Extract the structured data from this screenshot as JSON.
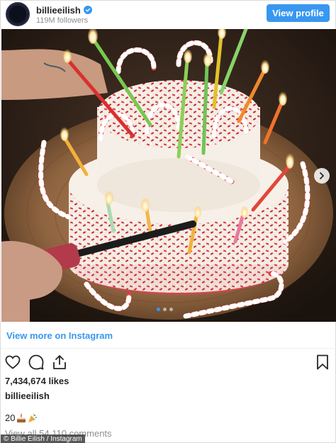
{
  "header": {
    "username": "billieeilish",
    "followers": "119M followers",
    "view_profile_label": "View profile"
  },
  "post": {
    "image_subject": "birthday cake with candy canes and lit candles",
    "carousel": {
      "count": 3,
      "active_index": 0
    },
    "view_more_label": "View more on Instagram",
    "likes": "7,434,674 likes",
    "caption_user": "billieeilish",
    "caption_text": "20",
    "view_comments": "View all 54,110 comments"
  },
  "icons": {
    "verified": "verified-badge-icon",
    "like": "heart-icon",
    "comment": "comment-icon",
    "share": "share-icon",
    "save": "bookmark-icon",
    "next": "chevron-right-icon"
  },
  "colors": {
    "accent": "#3897f0",
    "text": "#262626",
    "muted": "#8e8e8e"
  },
  "credit": "© Billie Eilish / Instagram"
}
